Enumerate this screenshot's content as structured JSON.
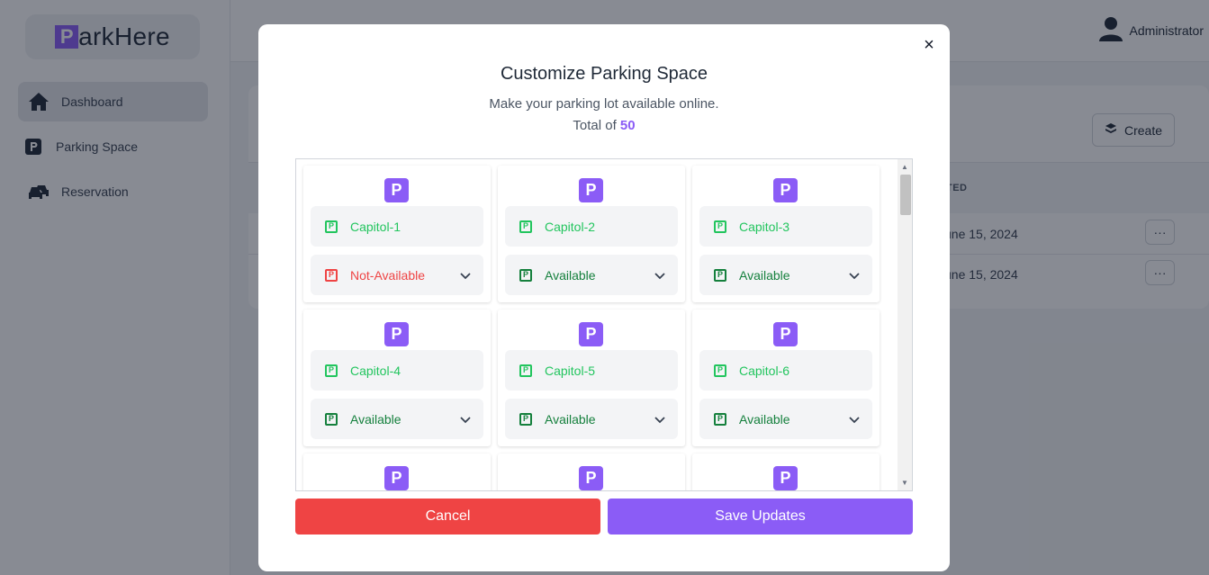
{
  "app": {
    "logo_mark": "P",
    "logo_text": "arkHere"
  },
  "sidebar": {
    "items": [
      {
        "label": "Dashboard",
        "icon": "home-icon"
      },
      {
        "label": "Parking Space",
        "icon": "parking-icon"
      },
      {
        "label": "Reservation",
        "icon": "car-icon"
      }
    ]
  },
  "header": {
    "user_label": "Administrator"
  },
  "background_card": {
    "create_label": "Create",
    "column_header_partial": "TED",
    "rows": [
      {
        "date": "une 15, 2024",
        "menu": "···"
      },
      {
        "date": "une 15, 2024",
        "menu": "···"
      }
    ]
  },
  "modal": {
    "close": "×",
    "title": "Customize Parking Space",
    "subtitle": "Make your parking lot available online.",
    "total_prefix": "Total of",
    "total_value": "50",
    "cancel_label": "Cancel",
    "save_label": "Save Updates",
    "tiles": [
      {
        "name": "Capitol-1",
        "status": "Not-Available"
      },
      {
        "name": "Capitol-2",
        "status": "Available"
      },
      {
        "name": "Capitol-3",
        "status": "Available"
      },
      {
        "name": "Capitol-4",
        "status": "Available"
      },
      {
        "name": "Capitol-5",
        "status": "Available"
      },
      {
        "name": "Capitol-6",
        "status": "Available"
      },
      {
        "name": "",
        "status": ""
      },
      {
        "name": "",
        "status": ""
      },
      {
        "name": "",
        "status": ""
      }
    ],
    "tile_badge": "P"
  },
  "colors": {
    "accent": "#8b5cf6",
    "danger": "#ef4444",
    "available": "#15803d",
    "name_green": "#22c55e"
  }
}
